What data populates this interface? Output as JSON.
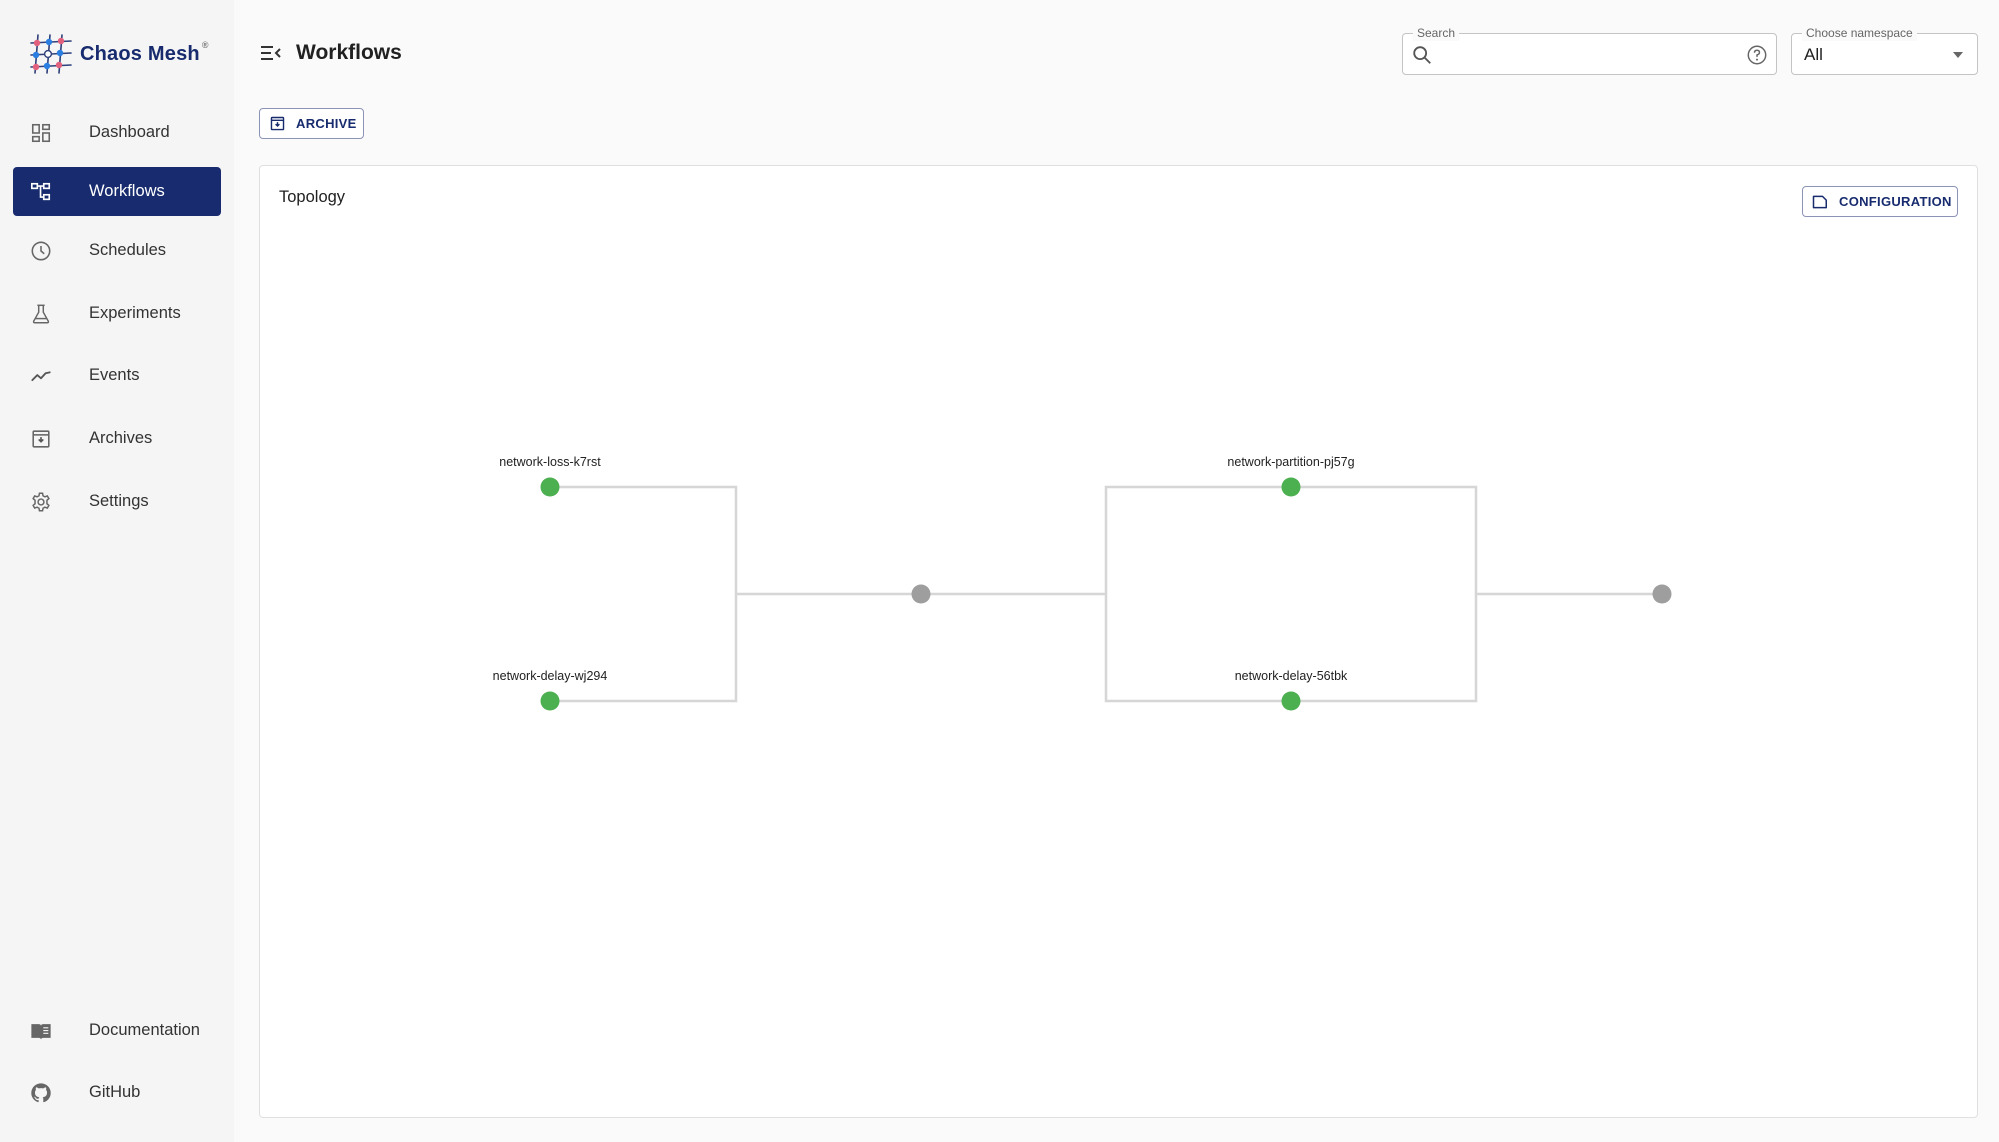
{
  "brand": {
    "name": "Chaos Mesh",
    "trademark": "®"
  },
  "sidebar": {
    "items": [
      {
        "label": "Dashboard",
        "icon": "dashboard-icon",
        "active": false
      },
      {
        "label": "Workflows",
        "icon": "workflow-icon",
        "active": true
      },
      {
        "label": "Schedules",
        "icon": "clock-icon",
        "active": false
      },
      {
        "label": "Experiments",
        "icon": "flask-icon",
        "active": false
      },
      {
        "label": "Events",
        "icon": "timeline-icon",
        "active": false
      },
      {
        "label": "Archives",
        "icon": "archive-icon",
        "active": false
      },
      {
        "label": "Settings",
        "icon": "gear-icon",
        "active": false
      }
    ],
    "footer_items": [
      {
        "label": "Documentation",
        "icon": "book-icon"
      },
      {
        "label": "GitHub",
        "icon": "github-icon"
      }
    ]
  },
  "header": {
    "title": "Workflows",
    "search": {
      "label": "Search",
      "value": "",
      "placeholder": ""
    },
    "namespace": {
      "label": "Choose namespace",
      "selected": "All"
    }
  },
  "toolbar": {
    "archive_label": "ARCHIVE"
  },
  "topology": {
    "title": "Topology",
    "configuration_label": "CONFIGURATION",
    "colors": {
      "success": "#4caf50",
      "pending": "#9e9e9e",
      "edge": "#d6d6d6",
      "brand": "#172b6e"
    },
    "nodes": [
      {
        "id": "n1",
        "name": "network-loss-k7rst",
        "status": "success"
      },
      {
        "id": "n2",
        "name": "network-delay-wj294",
        "status": "success"
      },
      {
        "id": "j1",
        "name": "",
        "status": "pending"
      },
      {
        "id": "n3",
        "name": "network-partition-pj57g",
        "status": "success"
      },
      {
        "id": "n4",
        "name": "network-delay-56tbk",
        "status": "success"
      },
      {
        "id": "j2",
        "name": "",
        "status": "pending"
      }
    ]
  }
}
